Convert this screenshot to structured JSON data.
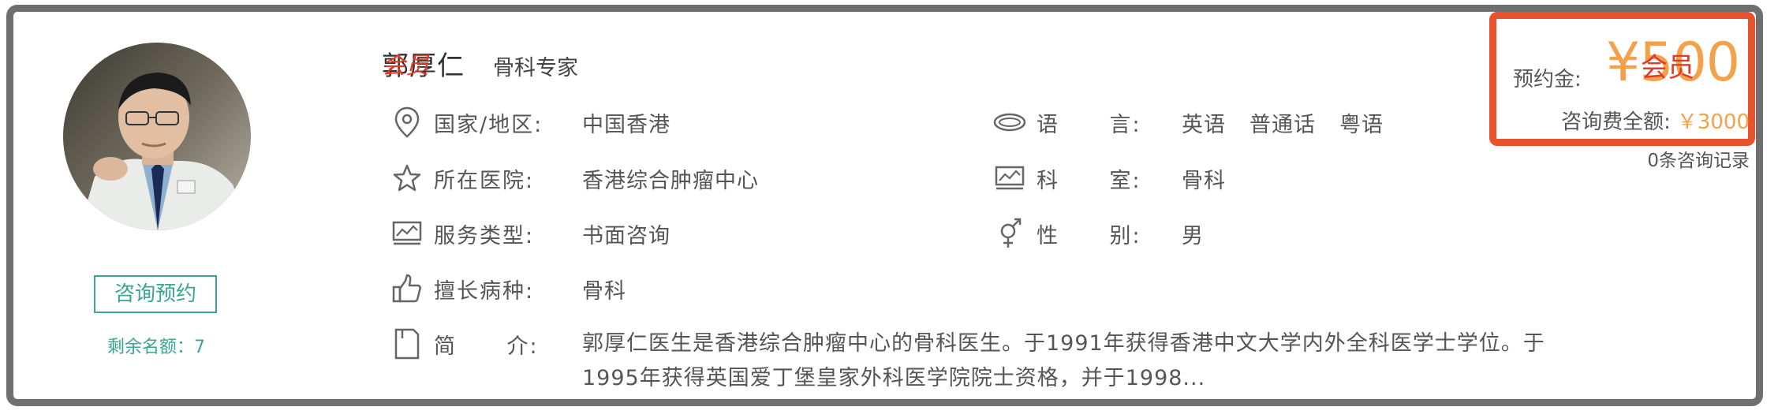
{
  "doctor": {
    "name": "郭厚仁",
    "title": "骨科专家",
    "stamp": "会员",
    "book_button": "咨询预约",
    "remaining_label": "剩余名额：7"
  },
  "info": {
    "country": {
      "label": "国家/地区:",
      "value": "中国香港",
      "icon": "location-pin-icon"
    },
    "hospital": {
      "label": "所在医院:",
      "value": "香港综合肿瘤中心",
      "icon": "star-icon"
    },
    "service": {
      "label": "服务类型:",
      "value": "书面咨询",
      "icon": "monitor-chart-icon"
    },
    "specialty": {
      "label": "擅长病种:",
      "value": "骨科",
      "icon": "thumbs-up-icon"
    },
    "intro": {
      "label": "简      介:",
      "value": "郭厚仁医生是香港综合肿瘤中心的骨科医生。于1991年获得香港中文大学内外全科医学士学位。于1995年获得英国爱丁堡皇家外科医学院院士资格，并于1998...",
      "icon": "document-icon"
    },
    "language": {
      "label": "语      言:",
      "values": [
        "英语",
        "普通话",
        "粤语"
      ],
      "icon": "speech-bubble-icon"
    },
    "department": {
      "label": "科      室:",
      "value": "骨科",
      "icon": "monitor-chart-icon"
    },
    "gender": {
      "label": "性      别:",
      "value": "男",
      "icon": "gender-icon"
    }
  },
  "pricing": {
    "deposit_label": "预约金:",
    "deposit_amount": "¥500",
    "deposit_stamp": "会员",
    "total_label": "咨询费全额:",
    "total_amount": "￥3000",
    "records": "0条咨询记录"
  },
  "colors": {
    "accent_green": "#3aa594",
    "price_orange": "#f3a24b",
    "highlight_border": "#e8532e",
    "card_border": "#6f6f6f"
  }
}
